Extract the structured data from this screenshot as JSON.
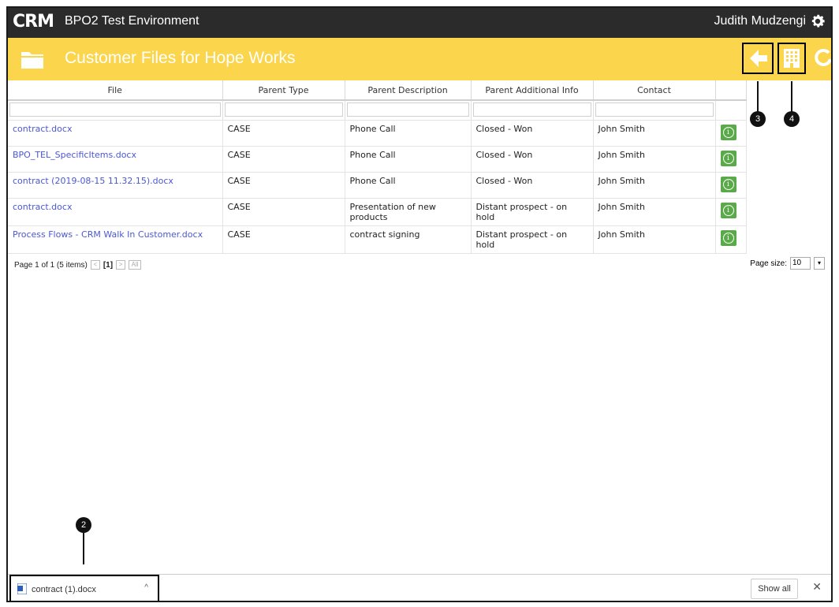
{
  "app": {
    "logo": "CRM",
    "env_title": "BPO2 Test Environment",
    "user_name": "Judith Mudzengi"
  },
  "header": {
    "title": "Customer Files for Hope Works"
  },
  "table": {
    "columns": [
      "File",
      "Parent Type",
      "Parent Description",
      "Parent Additional Info",
      "Contact"
    ],
    "rows": [
      {
        "file": "contract.docx",
        "parent_type": "CASE",
        "parent_description": "Phone Call",
        "parent_info": "Closed - Won",
        "contact": "John Smith"
      },
      {
        "file": "BPO_TEL_SpecificItems.docx",
        "parent_type": "CASE",
        "parent_description": "Phone Call",
        "parent_info": "Closed - Won",
        "contact": "John Smith"
      },
      {
        "file": "contract (2019-08-15 11.32.15).docx",
        "parent_type": "CASE",
        "parent_description": "Phone Call",
        "parent_info": "Closed - Won",
        "contact": "John Smith"
      },
      {
        "file": "contract.docx",
        "parent_type": "CASE",
        "parent_description": "Presentation of new products",
        "parent_info": "Distant prospect - on hold",
        "contact": "John Smith"
      },
      {
        "file": "Process Flows - CRM Walk In Customer.docx",
        "parent_type": "CASE",
        "parent_description": "contract signing",
        "parent_info": "Distant prospect - on hold",
        "contact": "John Smith"
      }
    ]
  },
  "pager": {
    "summary": "Page 1 of 1 (5 items)",
    "prev": "<",
    "current": "[1]",
    "next": ">",
    "all": "All",
    "page_size_label": "Page size:",
    "page_size": "10"
  },
  "callouts": {
    "c2": "2",
    "c3": "3",
    "c4": "4"
  },
  "download": {
    "file_name": "contract (1).docx",
    "show_all": "Show all",
    "close": "✕",
    "chevron": "^"
  },
  "colors": {
    "topbar": "#2b2b2b",
    "header_yellow": "#fbd54c",
    "link_blue": "#4b57d6",
    "info_green": "#5aaa4a"
  },
  "icons": [
    "gear-icon",
    "folder-icon",
    "back-arrow-icon",
    "building-icon",
    "refresh-icon",
    "info-icon",
    "word-doc-icon"
  ]
}
